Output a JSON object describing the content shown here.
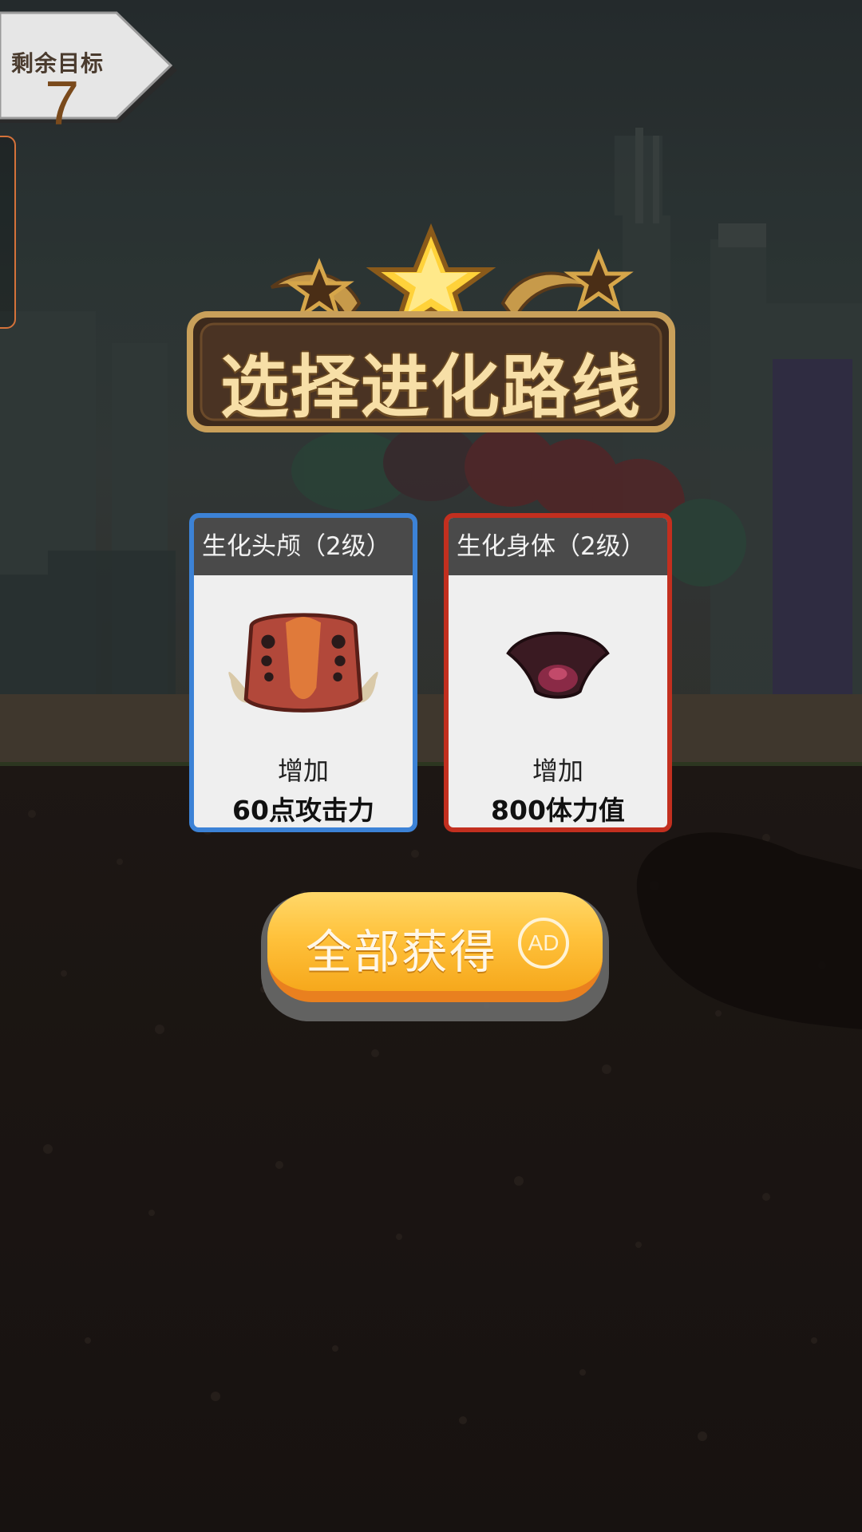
{
  "hud": {
    "remaining_target_label": "剩余目标",
    "remaining_target_value": "7"
  },
  "title": "选择进化路线",
  "cards": [
    {
      "header": "生化头颅（2级）",
      "increase_label": "增加",
      "bonus": "60点攻击力",
      "border_color": "#3c82d6",
      "icon": "bio-skull-icon"
    },
    {
      "header": "生化身体（2级）",
      "increase_label": "增加",
      "bonus": "800体力值",
      "border_color": "#c22f1f",
      "icon": "bio-body-icon"
    }
  ],
  "get_all_button": {
    "label": "全部获得",
    "ad_badge": "AD"
  },
  "colors": {
    "button_yellow": "#ffc23c",
    "title_gold": "#f7dfa7"
  }
}
